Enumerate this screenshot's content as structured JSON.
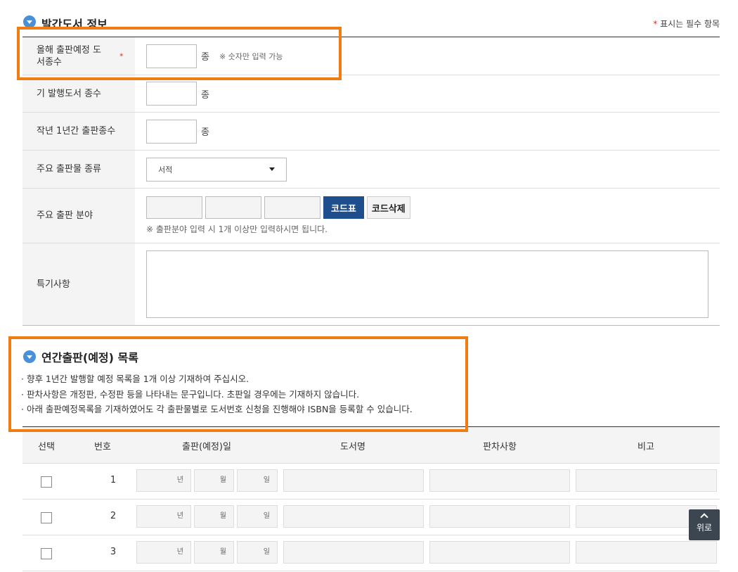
{
  "section1": {
    "title": "발간도서 정보",
    "required_note_star": "*",
    "required_note": "표시는 필수 항목"
  },
  "form": {
    "row1": {
      "label": "올해 출판예정 도서종수",
      "req": "*",
      "unit": "종",
      "hint": "※ 숫자만 입력 가능"
    },
    "row2": {
      "label": "기 발행도서 종수",
      "unit": "종"
    },
    "row3": {
      "label": "작년 1년간 출판종수",
      "unit": "종"
    },
    "row4": {
      "label": "주요 출판물 종류",
      "select_value": "서적"
    },
    "row5": {
      "label": "주요 출판 분야",
      "btn_code": "코드표",
      "btn_delete": "코드삭제",
      "hint": "※ 출판분야 입력 시 1개 이상만 입력하시면 됩니다."
    },
    "row6": {
      "label": "특기사항"
    }
  },
  "section2": {
    "title": "연간출판(예정) 목록",
    "notes": [
      "향후 1년간 발행할 예정 목록을 1개 이상 기재하여 주십시오.",
      "판차사항은 개정판, 수정판 등을 나타내는 문구입니다. 초판일 경우에는 기재하지 않습니다.",
      "아래 출판예정목록을 기재하였어도 각 출판물별로 도서번호 신청을 진행해야 ISBN을 등록할 수 있습니다."
    ]
  },
  "list": {
    "headers": {
      "select": "선택",
      "number": "번호",
      "date": "출판(예정)일",
      "title": "도서명",
      "edition": "판차사항",
      "remarks": "비고"
    },
    "date_units": {
      "year": "년",
      "month": "월",
      "day": "일"
    },
    "rows": [
      {
        "number": "1"
      },
      {
        "number": "2"
      },
      {
        "number": "3"
      }
    ]
  },
  "top_button": {
    "label": "위로"
  },
  "colors": {
    "highlight": "#f07c14",
    "primary_button": "#1f4e8c",
    "accent_icon": "#4a90d9",
    "required": "#c0392b"
  }
}
